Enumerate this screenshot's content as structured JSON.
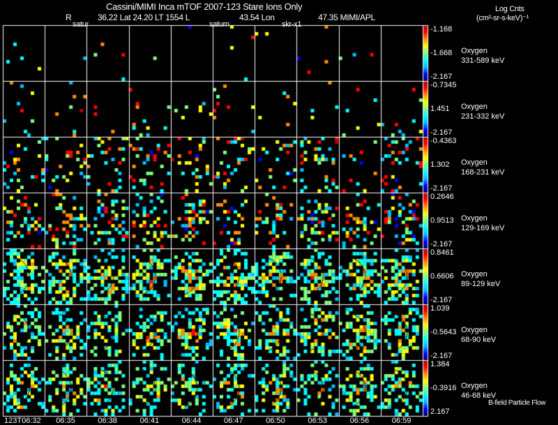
{
  "header": {
    "title": "Cassini/MIMI Inca mTOF  2007-123   Stare   Ions Only",
    "r_label": "R",
    "ephemeris": "36.22 Lat 24.20 LT 1554 L",
    "lon": "43.54 Lon",
    "lval": "47.35  MIMI/APL",
    "units_title": "Log Cnts",
    "units": "(cm²-sr-s-keV)⁻¹",
    "markers": [
      "satur",
      "saturn",
      "skr-x1"
    ]
  },
  "footer": {
    "legend_note": "B-field Particle Flow"
  },
  "chart_data": {
    "type": "heatmap",
    "title": "Cassini/MIMI Inca mTOF 2007-123 Stare Ions Only",
    "colormap": [
      "#00008b",
      "#0000ff",
      "#00bfff",
      "#00ffff",
      "#7fff7f",
      "#ffff00",
      "#ff8c00",
      "#ff0000",
      "#b00000"
    ],
    "time_labels": [
      "123T06:32",
      "06:35",
      "06:38",
      "06:41",
      "06:44",
      "06:47",
      "06:50",
      "06:53",
      "06:56",
      "06:59"
    ],
    "rows": [
      {
        "species": "Oxygen",
        "energy": "331-589 keV",
        "max": "-1.168",
        "mid": "-1.668",
        "min": "-2.167"
      },
      {
        "species": "Oxygen",
        "energy": "231-332 keV",
        "max": "-0.7345",
        "mid": "1.451",
        "min": "-2.167"
      },
      {
        "species": "Oxygen",
        "energy": "168-231 keV",
        "max": "-0.4363",
        "mid": "1.302",
        "min": "-2.167"
      },
      {
        "species": "Oxygen",
        "energy": "129-169 keV",
        "max": "0.2646",
        "mid": "0.9513",
        "min": "-2.167"
      },
      {
        "species": "Oxygen",
        "energy": "89-129 keV",
        "max": "0.8461",
        "mid": "0.6606",
        "min": "-2.167"
      },
      {
        "species": "Oxygen",
        "energy": "68-90 keV",
        "max": "1.039",
        "mid": "-0.5643",
        "min": "-2.167"
      },
      {
        "species": "Oxygen",
        "energy": "46-68 keV",
        "max": "1.384",
        "mid": "-0.3916",
        "min": "2.167"
      }
    ],
    "row_density": [
      0.01,
      0.04,
      0.12,
      0.35,
      0.6,
      0.5,
      0.45
    ]
  }
}
